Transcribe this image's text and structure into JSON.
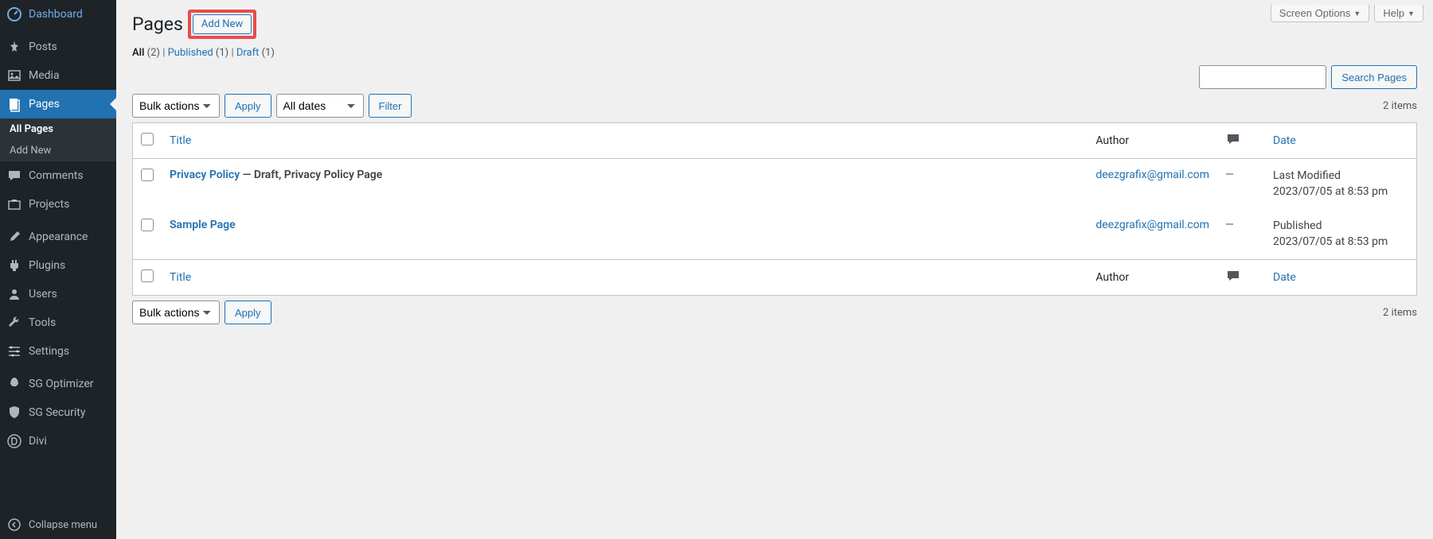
{
  "sidebar": {
    "items": [
      {
        "label": "Dashboard",
        "icon": "dashboard"
      },
      {
        "label": "Posts",
        "icon": "pin"
      },
      {
        "label": "Media",
        "icon": "media"
      },
      {
        "label": "Pages",
        "icon": "page",
        "current": true
      },
      {
        "label": "Comments",
        "icon": "comment"
      },
      {
        "label": "Projects",
        "icon": "portfolio"
      },
      {
        "label": "Appearance",
        "icon": "brush"
      },
      {
        "label": "Plugins",
        "icon": "plug"
      },
      {
        "label": "Users",
        "icon": "user"
      },
      {
        "label": "Tools",
        "icon": "wrench"
      },
      {
        "label": "Settings",
        "icon": "sliders"
      },
      {
        "label": "SG Optimizer",
        "icon": "rocket"
      },
      {
        "label": "SG Security",
        "icon": "shield"
      },
      {
        "label": "Divi",
        "icon": "divi"
      }
    ],
    "submenu": {
      "all_pages": "All Pages",
      "add_new": "Add New"
    },
    "collapse": "Collapse menu"
  },
  "top": {
    "screen_options": "Screen Options",
    "help": "Help"
  },
  "heading": {
    "title": "Pages",
    "add_new": "Add New"
  },
  "filters": {
    "all_label": "All",
    "all_count": "(2)",
    "published_label": "Published",
    "published_count": "(1)",
    "draft_label": "Draft",
    "draft_count": "(1)",
    "sep": " | "
  },
  "actions": {
    "bulk": "Bulk actions",
    "apply": "Apply",
    "all_dates": "All dates",
    "filter": "Filter",
    "search_pages": "Search Pages",
    "items_count": "2 items"
  },
  "table": {
    "headers": {
      "title": "Title",
      "author": "Author",
      "date": "Date"
    },
    "rows": [
      {
        "title": "Privacy Policy",
        "state": " — Draft, Privacy Policy Page",
        "author": "deezgrafix@gmail.com",
        "comments": "—",
        "date_status": "Last Modified",
        "date_value": "2023/07/05 at 8:53 pm"
      },
      {
        "title": "Sample Page",
        "state": "",
        "author": "deezgrafix@gmail.com",
        "comments": "—",
        "date_status": "Published",
        "date_value": "2023/07/05 at 8:53 pm"
      }
    ]
  }
}
